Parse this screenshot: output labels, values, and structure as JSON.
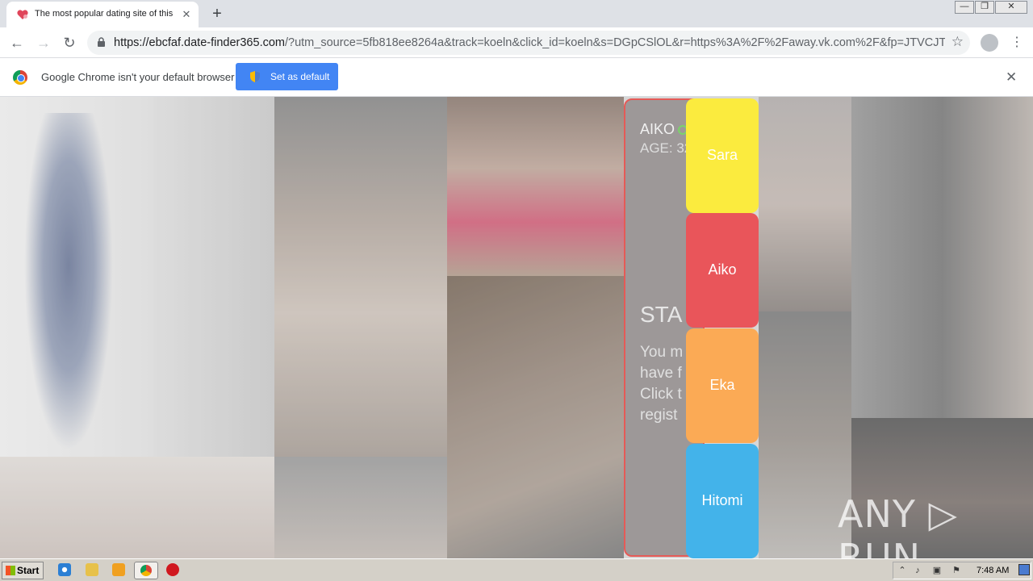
{
  "browser": {
    "tab_title": "The most popular dating site of this",
    "tab_close": "✕",
    "new_tab": "+",
    "window_controls": {
      "minimize": "—",
      "restore": "❐",
      "close": "✕"
    },
    "url_host": "https://ebcfaf.date-finder365.com",
    "url_rest": "/?utm_source=5fb818ee8264a&track=koeln&click_id=koeln&s=DGpCSlOL&r=https%3A%2F%2Faway.vk.com%2F&fp=JTVCJTd...",
    "infobar_message": "Google Chrome isn't your default browser",
    "infobar_button": "Set as default",
    "infobar_close": "✕"
  },
  "profile_card": {
    "name": "AIKO",
    "age": "AGE: 32",
    "heading": "STA",
    "body_lines": [
      "You m",
      "have f",
      "Click t",
      "regist"
    ]
  },
  "name_list": [
    {
      "label": "Sara",
      "color": "#fbeb3e"
    },
    {
      "label": "Aiko",
      "color": "#e9555a"
    },
    {
      "label": "Eka",
      "color": "#fbaa55"
    },
    {
      "label": "Hitomi",
      "color": "#43b3ea"
    }
  ],
  "watermark": "ANY ▷ RUN",
  "taskbar": {
    "start_label": "Start",
    "clock": "7:48 AM"
  },
  "icons": [
    "favicon-heart-icon",
    "back-icon",
    "forward-icon",
    "reload-icon",
    "lock-icon",
    "star-icon",
    "profile-icon",
    "menu-icon",
    "chrome-logo-icon",
    "shield-icon",
    "windows-flag-icon",
    "ie-icon",
    "folder-icon",
    "media-player-icon",
    "chrome-icon",
    "avira-icon"
  ]
}
